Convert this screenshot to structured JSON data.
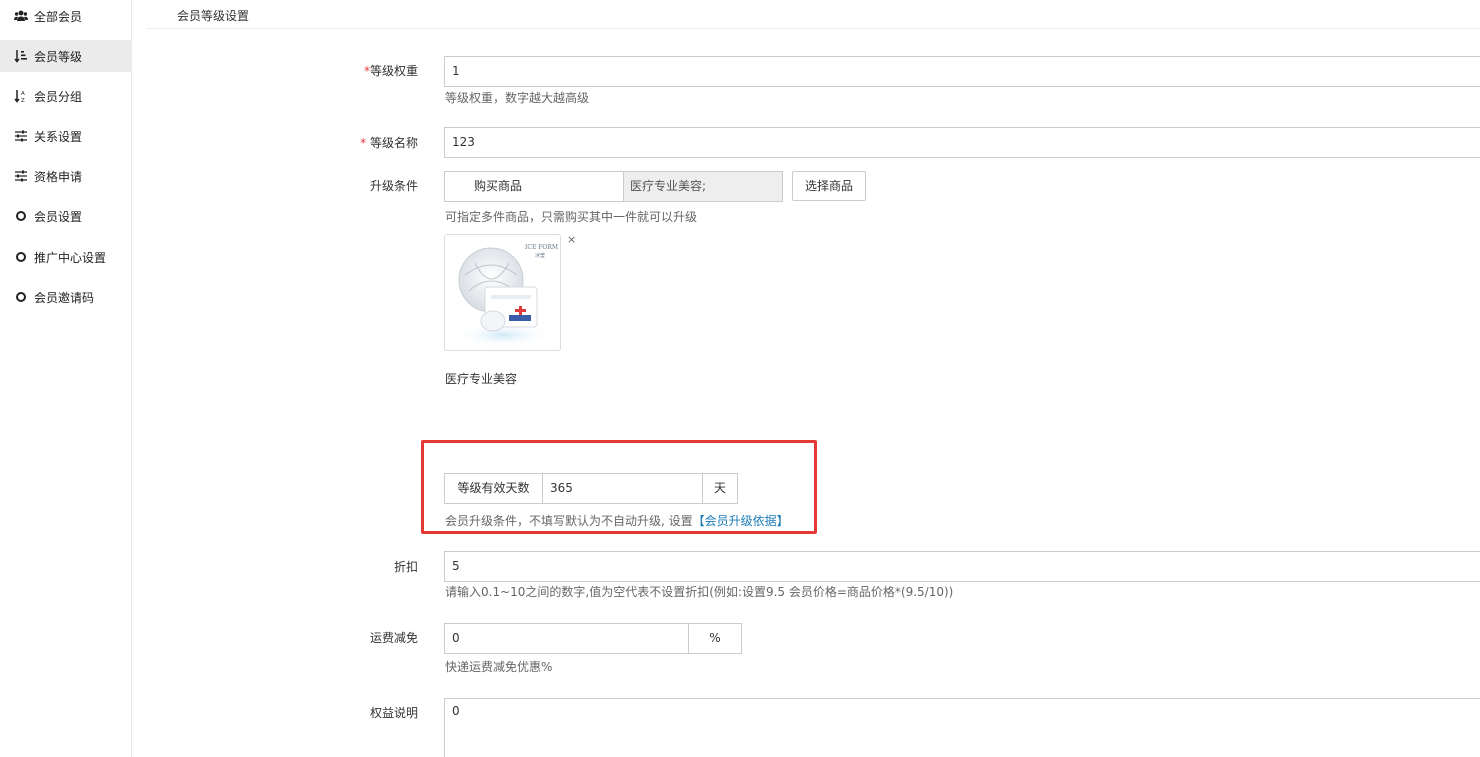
{
  "sidebar": {
    "items": [
      {
        "label": "全部会员",
        "icon": "users-icon"
      },
      {
        "label": "会员等级",
        "icon": "sort-amount-icon"
      },
      {
        "label": "会员分组",
        "icon": "sort-alpha-icon"
      },
      {
        "label": "关系设置",
        "icon": "sliders-icon"
      },
      {
        "label": "资格申请",
        "icon": "sliders-icon"
      },
      {
        "label": "会员设置",
        "icon": "circle-icon"
      },
      {
        "label": "推广中心设置",
        "icon": "circle-icon"
      },
      {
        "label": "会员邀请码",
        "icon": "circle-icon"
      }
    ],
    "active_index": 1
  },
  "page": {
    "title": "会员等级设置"
  },
  "form": {
    "weight": {
      "required_mark": "*",
      "label": "等级权重",
      "value": "1",
      "help": "等级权重，数字越大越高级"
    },
    "name": {
      "required_mark": "*",
      "label": "等级名称",
      "value": "123"
    },
    "upgrade": {
      "label": "升级条件",
      "condition_label": "购买商品",
      "selected_goods": "医疗专业美容;",
      "select_button": "选择商品",
      "help": "可指定多件商品，只需购买其中一件就可以升级",
      "goods_name": "医疗专业美容",
      "remove": "×",
      "product_brand": "ICE FORM",
      "product_brand_sub": "冰莹"
    },
    "validity": {
      "label": "等级有效天数",
      "value": "365",
      "unit": "天",
      "help": "会员升级条件，不填写默认为不自动升级, 设置",
      "help_link": "【会员升级依据】"
    },
    "discount": {
      "label": "折扣",
      "value": "5",
      "help": "请输入0.1~10之间的数字,值为空代表不设置折扣(例如:设置9.5 会员价格=商品价格*(9.5/10))"
    },
    "freight": {
      "label": "运费减免",
      "value": "0",
      "unit": "%",
      "help": "快递运费减免优惠%"
    },
    "rights": {
      "label": "权益说明",
      "value": "0"
    }
  },
  "colors": {
    "highlight": "#e53935",
    "link": "#1a7bb9",
    "required": "#e4393c",
    "active_bg": "#ebebeb"
  }
}
